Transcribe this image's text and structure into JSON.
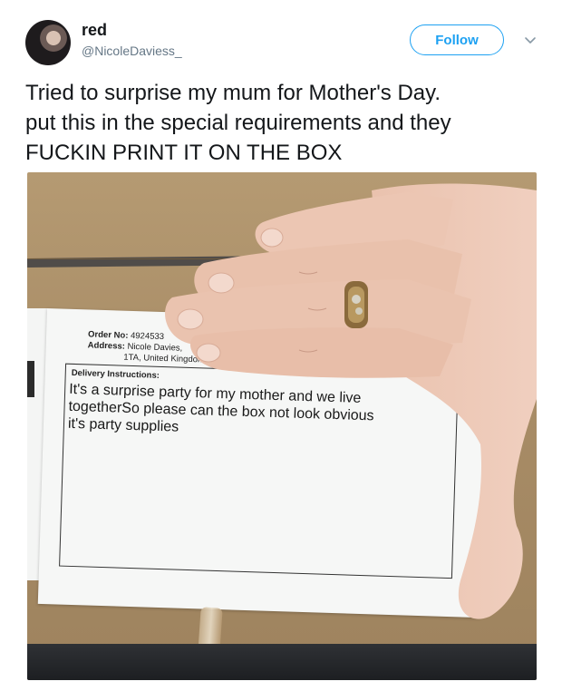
{
  "user": {
    "display_name": "red",
    "handle": "@NicoleDaviess_"
  },
  "actions": {
    "follow_label": "Follow",
    "menu_icon": "chevron-down-icon"
  },
  "tweet": {
    "text_lines": [
      "Tried to surprise my mum for Mother's Day.",
      "put this in the special requirements and they",
      "FUCKIN PRINT IT ON THE BOX"
    ]
  },
  "photo_label": {
    "order_no_label": "Order No:",
    "order_no": "4924533",
    "address_label": "Address:",
    "address_line1": "Nicole Davies,",
    "address_line2": "1TA, United Kingdom",
    "instructions_title": "Delivery Instructions:",
    "instruction_lines": [
      "It's a surprise party for my mother and we live",
      "togetherSo please can the box not look obvious",
      "it's party supplies"
    ]
  },
  "colors": {
    "accent": "#1da1f2",
    "text": "#14171a",
    "secondary_text": "#657786",
    "cardboard": "#a98d67"
  }
}
